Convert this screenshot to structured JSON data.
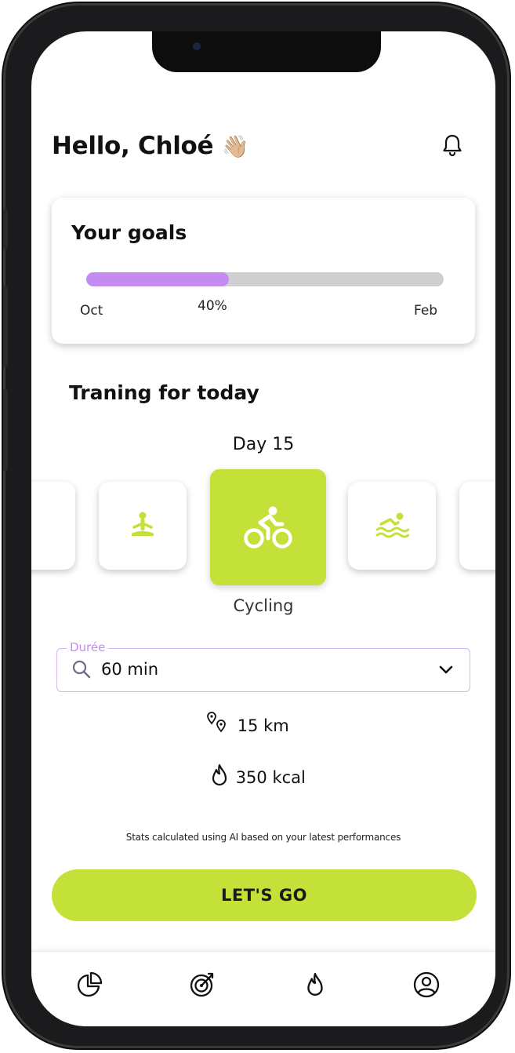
{
  "header": {
    "greeting": "Hello, Chloé",
    "greeting_emoji": "👋🏼",
    "bell_icon": "bell-icon"
  },
  "goals": {
    "title": "Your goals",
    "progress_label": "40%",
    "progress_value": 0.4,
    "start_label": "Oct",
    "end_label": "Feb"
  },
  "training": {
    "title": "Traning for today",
    "day_label": "Day 15",
    "selected_activity": "Cycling",
    "activities": [
      "partial-card-icon",
      "meditation-icon",
      "cycling-icon",
      "swimming-icon",
      "partial-card-icon"
    ]
  },
  "duration": {
    "legend": "Durée",
    "value": "60 min"
  },
  "stats": {
    "distance": "15 km",
    "calories": "350 kcal",
    "disclaimer": "Stats calculated using AI based on your latest performances"
  },
  "cta": {
    "label": "LET'S GO"
  },
  "nav": [
    "stats-pie-icon",
    "target-icon",
    "flame-icon",
    "profile-icon"
  ],
  "colors": {
    "accent_green": "#c4e13a",
    "accent_purple": "#c48cf2",
    "track_gray": "#cfcfcf"
  }
}
